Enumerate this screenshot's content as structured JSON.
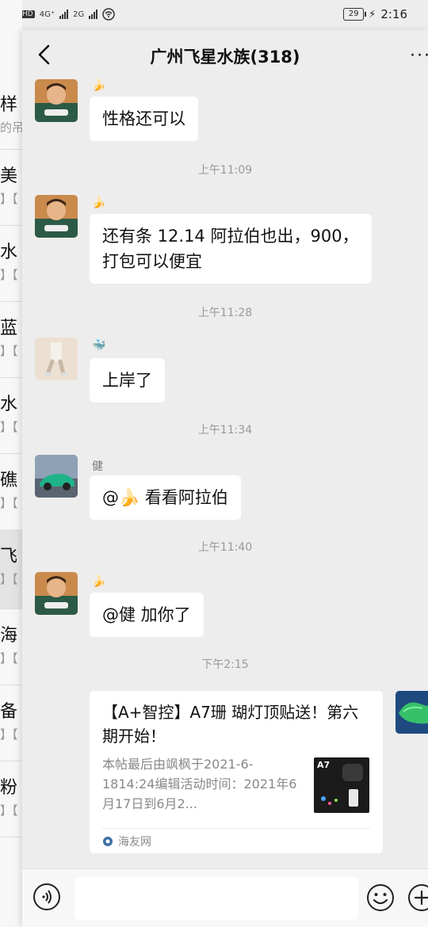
{
  "status_bar": {
    "left": [
      "HD",
      "4G⁺",
      "2G"
    ],
    "battery": "29",
    "time": "2:16"
  },
  "background_list": [
    {
      "title": "样",
      "subtitle": "的吊"
    },
    {
      "title": "美",
      "subtitle": "】【"
    },
    {
      "title": "水",
      "subtitle": "】【"
    },
    {
      "title": "蓝",
      "subtitle": "】【"
    },
    {
      "title": "水",
      "subtitle": "】【"
    },
    {
      "title": "礁",
      "subtitle": "】【"
    },
    {
      "title": "飞",
      "subtitle": "】【"
    },
    {
      "title": "海",
      "subtitle": "】【"
    },
    {
      "title": "备",
      "subtitle": "】【"
    },
    {
      "title": "粉",
      "subtitle": "】【"
    }
  ],
  "header": {
    "title": "广州飞星水族(318)",
    "back_icon": "chevron-left-icon",
    "more_icon": "more-dots-icon"
  },
  "messages": [
    {
      "nick": "🍌",
      "text": "性格还可以"
    },
    {
      "time": "上午11:09"
    },
    {
      "nick": "🍌",
      "text": "还有条 12.14 阿拉伯也出，900，\n打包可以便宜"
    },
    {
      "time": "上午11:28"
    },
    {
      "nick": "🐳",
      "text": "上岸了"
    },
    {
      "time": "上午11:34"
    },
    {
      "nick": "健",
      "text": "@🍌  看看阿拉伯"
    },
    {
      "time": "上午11:40"
    },
    {
      "nick": "🍌",
      "text": "@健  加你了"
    },
    {
      "time": "下午2:15"
    }
  ],
  "link_card": {
    "title": "【A+智控】A7珊 瑚灯顶贴送！第六期开始！",
    "description": "本帖最后由飒枫于2021-6-1814:24编辑活动时间：2021年6月17日到6月2...",
    "thumb_label": "A7",
    "source": "海友网"
  },
  "input_bar": {
    "voice_icon": "voice-icon",
    "emoji_icon": "emoji-icon",
    "plus_icon": "plus-icon",
    "placeholder": ""
  },
  "colors": {
    "background": "#ededed",
    "bubble": "#ffffff",
    "time_text": "#999999"
  }
}
